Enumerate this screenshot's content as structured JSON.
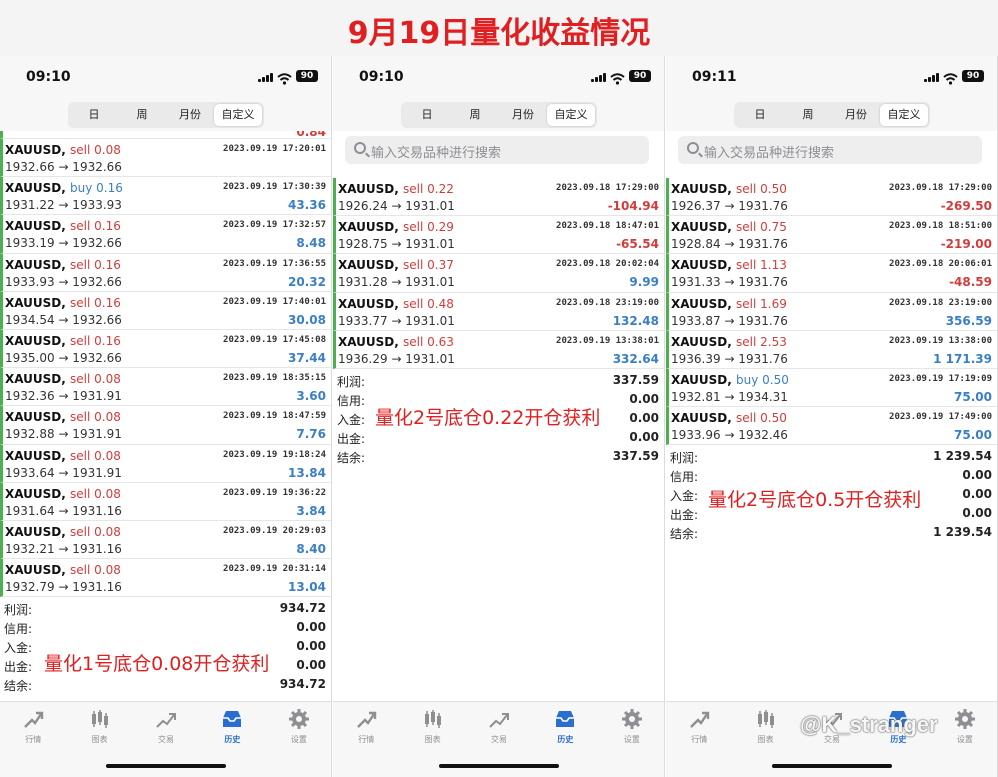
{
  "banner": {
    "title": "9月19日量化收益情况"
  },
  "colors": {
    "sell": "#d23c3c",
    "buy": "#3a7fc6",
    "positive": "#3a7fc6",
    "negative": "#d23c3c",
    "annotation": "#e02020",
    "active_tab": "#2a6fd0"
  },
  "phones": [
    {
      "time": "09:10",
      "battery": "90",
      "segments": [
        "日",
        "周",
        "月份",
        "自定义"
      ],
      "active_segment": 3,
      "partial_value": "0.84",
      "trades": [
        {
          "symbol": "XAUUSD,",
          "side": "sell 0.08",
          "type": "sell",
          "datetime": "2023.09.19 17:20:01",
          "prices": "1932.66 → 1932.66",
          "profit": "",
          "sign": "pos"
        },
        {
          "symbol": "XAUUSD,",
          "side": "buy 0.16",
          "type": "buy",
          "datetime": "2023.09.19 17:30:39",
          "prices": "1931.22 → 1933.93",
          "profit": "43.36",
          "sign": "pos"
        },
        {
          "symbol": "XAUUSD,",
          "side": "sell 0.16",
          "type": "sell",
          "datetime": "2023.09.19 17:32:57",
          "prices": "1933.19 → 1932.66",
          "profit": "8.48",
          "sign": "pos"
        },
        {
          "symbol": "XAUUSD,",
          "side": "sell 0.16",
          "type": "sell",
          "datetime": "2023.09.19 17:36:55",
          "prices": "1933.93 → 1932.66",
          "profit": "20.32",
          "sign": "pos"
        },
        {
          "symbol": "XAUUSD,",
          "side": "sell 0.16",
          "type": "sell",
          "datetime": "2023.09.19 17:40:01",
          "prices": "1934.54 → 1932.66",
          "profit": "30.08",
          "sign": "pos"
        },
        {
          "symbol": "XAUUSD,",
          "side": "sell 0.16",
          "type": "sell",
          "datetime": "2023.09.19 17:45:08",
          "prices": "1935.00 → 1932.66",
          "profit": "37.44",
          "sign": "pos"
        },
        {
          "symbol": "XAUUSD,",
          "side": "sell 0.08",
          "type": "sell",
          "datetime": "2023.09.19 18:35:15",
          "prices": "1932.36 → 1931.91",
          "profit": "3.60",
          "sign": "pos"
        },
        {
          "symbol": "XAUUSD,",
          "side": "sell 0.08",
          "type": "sell",
          "datetime": "2023.09.19 18:47:59",
          "prices": "1932.88 → 1931.91",
          "profit": "7.76",
          "sign": "pos"
        },
        {
          "symbol": "XAUUSD,",
          "side": "sell 0.08",
          "type": "sell",
          "datetime": "2023.09.19 19:18:24",
          "prices": "1933.64 → 1931.91",
          "profit": "13.84",
          "sign": "pos"
        },
        {
          "symbol": "XAUUSD,",
          "side": "sell 0.08",
          "type": "sell",
          "datetime": "2023.09.19 19:36:22",
          "prices": "1931.64 → 1931.16",
          "profit": "3.84",
          "sign": "pos"
        },
        {
          "symbol": "XAUUSD,",
          "side": "sell 0.08",
          "type": "sell",
          "datetime": "2023.09.19 20:29:03",
          "prices": "1932.21 → 1931.16",
          "profit": "8.40",
          "sign": "pos"
        },
        {
          "symbol": "XAUUSD,",
          "side": "sell 0.08",
          "type": "sell",
          "datetime": "2023.09.19 20:31:14",
          "prices": "1932.79 → 1931.16",
          "profit": "13.04",
          "sign": "pos"
        }
      ],
      "summary": [
        {
          "label": "利润:",
          "value": "934.72"
        },
        {
          "label": "信用:",
          "value": "0.00"
        },
        {
          "label": "入金:",
          "value": "0.00"
        },
        {
          "label": "出金:",
          "value": "0.00"
        },
        {
          "label": "结余:",
          "value": "934.72"
        }
      ],
      "annotation": "量化1号底仓0.08开仓获利"
    },
    {
      "time": "09:10",
      "battery": "90",
      "segments": [
        "日",
        "周",
        "月份",
        "自定义"
      ],
      "active_segment": 3,
      "search_placeholder": "输入交易品种进行搜索",
      "trades": [
        {
          "symbol": "XAUUSD,",
          "side": "sell 0.22",
          "type": "sell",
          "datetime": "2023.09.18 17:29:00",
          "prices": "1926.24 → 1931.01",
          "profit": "-104.94",
          "sign": "neg"
        },
        {
          "symbol": "XAUUSD,",
          "side": "sell 0.29",
          "type": "sell",
          "datetime": "2023.09.18 18:47:01",
          "prices": "1928.75 → 1931.01",
          "profit": "-65.54",
          "sign": "neg"
        },
        {
          "symbol": "XAUUSD,",
          "side": "sell 0.37",
          "type": "sell",
          "datetime": "2023.09.18 20:02:04",
          "prices": "1931.28 → 1931.01",
          "profit": "9.99",
          "sign": "pos"
        },
        {
          "symbol": "XAUUSD,",
          "side": "sell 0.48",
          "type": "sell",
          "datetime": "2023.09.18 23:19:00",
          "prices": "1933.77 → 1931.01",
          "profit": "132.48",
          "sign": "pos"
        },
        {
          "symbol": "XAUUSD,",
          "side": "sell 0.63",
          "type": "sell",
          "datetime": "2023.09.19 13:38:01",
          "prices": "1936.29 → 1931.01",
          "profit": "332.64",
          "sign": "pos"
        }
      ],
      "summary": [
        {
          "label": "利润:",
          "value": "337.59"
        },
        {
          "label": "信用:",
          "value": "0.00"
        },
        {
          "label": "入金:",
          "value": "0.00"
        },
        {
          "label": "出金:",
          "value": "0.00"
        },
        {
          "label": "结余:",
          "value": "337.59"
        }
      ],
      "annotation": "量化2号底仓0.22开仓获利"
    },
    {
      "time": "09:11",
      "battery": "90",
      "segments": [
        "日",
        "周",
        "月份",
        "自定义"
      ],
      "active_segment": 3,
      "search_placeholder": "输入交易品种进行搜索",
      "trades": [
        {
          "symbol": "XAUUSD,",
          "side": "sell 0.50",
          "type": "sell",
          "datetime": "2023.09.18 17:29:00",
          "prices": "1926.37 → 1931.76",
          "profit": "-269.50",
          "sign": "neg"
        },
        {
          "symbol": "XAUUSD,",
          "side": "sell 0.75",
          "type": "sell",
          "datetime": "2023.09.18 18:51:00",
          "prices": "1928.84 → 1931.76",
          "profit": "-219.00",
          "sign": "neg"
        },
        {
          "symbol": "XAUUSD,",
          "side": "sell 1.13",
          "type": "sell",
          "datetime": "2023.09.18 20:06:01",
          "prices": "1931.33 → 1931.76",
          "profit": "-48.59",
          "sign": "neg"
        },
        {
          "symbol": "XAUUSD,",
          "side": "sell 1.69",
          "type": "sell",
          "datetime": "2023.09.18 23:19:00",
          "prices": "1933.87 → 1931.76",
          "profit": "356.59",
          "sign": "pos"
        },
        {
          "symbol": "XAUUSD,",
          "side": "sell 2.53",
          "type": "sell",
          "datetime": "2023.09.19 13:38:00",
          "prices": "1936.39 → 1931.76",
          "profit": "1 171.39",
          "sign": "pos"
        },
        {
          "symbol": "XAUUSD,",
          "side": "buy 0.50",
          "type": "buy",
          "datetime": "2023.09.19 17:19:09",
          "prices": "1932.81 → 1934.31",
          "profit": "75.00",
          "sign": "pos"
        },
        {
          "symbol": "XAUUSD,",
          "side": "sell 0.50",
          "type": "sell",
          "datetime": "2023.09.19 17:49:00",
          "prices": "1933.96 → 1932.46",
          "profit": "75.00",
          "sign": "pos"
        }
      ],
      "summary": [
        {
          "label": "利润:",
          "value": "1 239.54"
        },
        {
          "label": "信用:",
          "value": "0.00"
        },
        {
          "label": "入金:",
          "value": "0.00"
        },
        {
          "label": "出金:",
          "value": "0.00"
        },
        {
          "label": "结余:",
          "value": "1 239.54"
        }
      ],
      "annotation": "量化2号底仓0.5开仓获利"
    }
  ],
  "tabbar": {
    "items": [
      {
        "label": "行情",
        "icon": "quotes-icon"
      },
      {
        "label": "图表",
        "icon": "chart-icon"
      },
      {
        "label": "交易",
        "icon": "trade-icon"
      },
      {
        "label": "历史",
        "icon": "history-icon"
      },
      {
        "label": "设置",
        "icon": "settings-icon"
      }
    ],
    "active": 3
  },
  "watermark": "@K_stranger"
}
